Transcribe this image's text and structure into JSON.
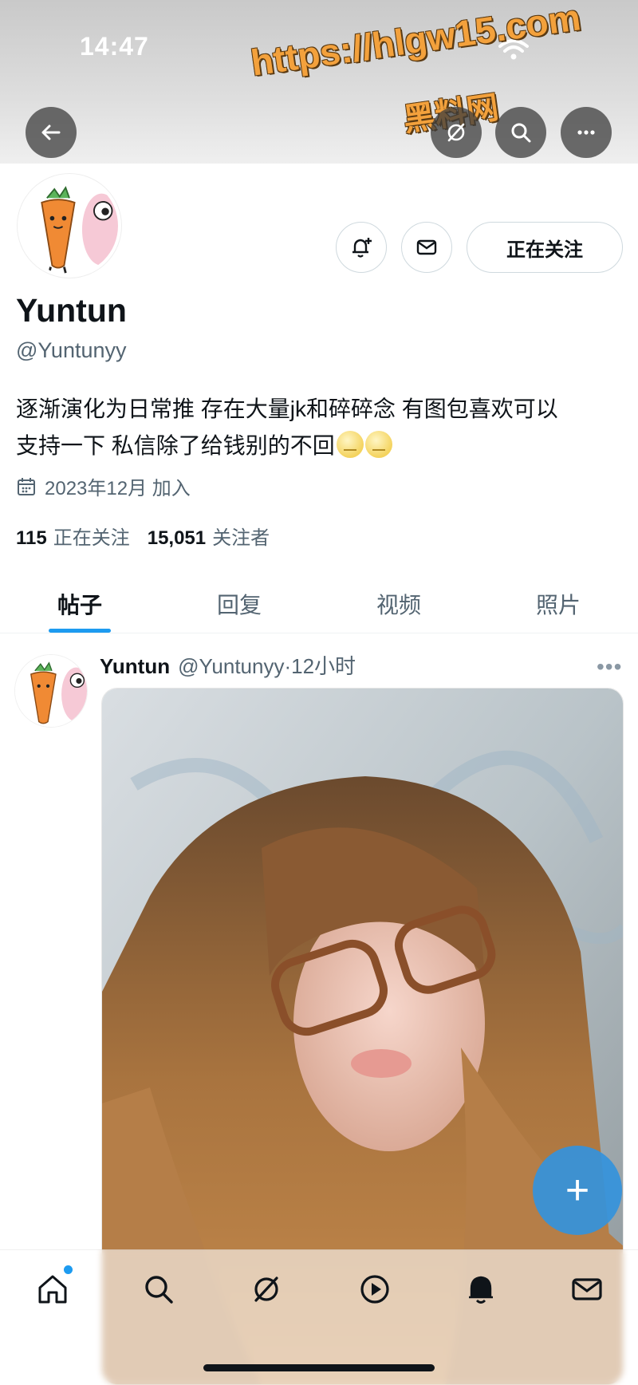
{
  "status_bar": {
    "time": "14:47"
  },
  "watermark": {
    "url": "https://hlgw15.com",
    "name": "黑料网"
  },
  "header": {
    "icons": [
      "back-arrow-icon",
      "grok-icon",
      "search-icon",
      "more-icon"
    ]
  },
  "profile": {
    "display_name": "Yuntun",
    "handle": "@Yuntunyy",
    "bio_line1": "逐渐演化为日常推 存在大量jk和碎碎念 有图包喜欢可以",
    "bio_line2": "支持一下 私信除了给钱别的不回",
    "joined": "2023年12月 加入",
    "following_count": "115",
    "following_label": "正在关注",
    "followers_count": "15,051",
    "followers_label": "关注者",
    "follow_button_label": "正在关注"
  },
  "tabs": [
    {
      "label": "帖子",
      "active": true
    },
    {
      "label": "回复",
      "active": false
    },
    {
      "label": "视频",
      "active": false
    },
    {
      "label": "照片",
      "active": false
    }
  ],
  "post": {
    "author_name": "Yuntun",
    "author_handle": "@Yuntunyy",
    "time": "12小时"
  },
  "fab": {
    "label": "+"
  },
  "bottom_nav": [
    "home-icon",
    "search-icon",
    "grok-icon",
    "video-icon",
    "notifications-icon",
    "messages-icon"
  ],
  "colors": {
    "accent": "#1d9bf0",
    "text": "#0f1419",
    "muted": "#536471",
    "watermark": "#f3a13c"
  }
}
